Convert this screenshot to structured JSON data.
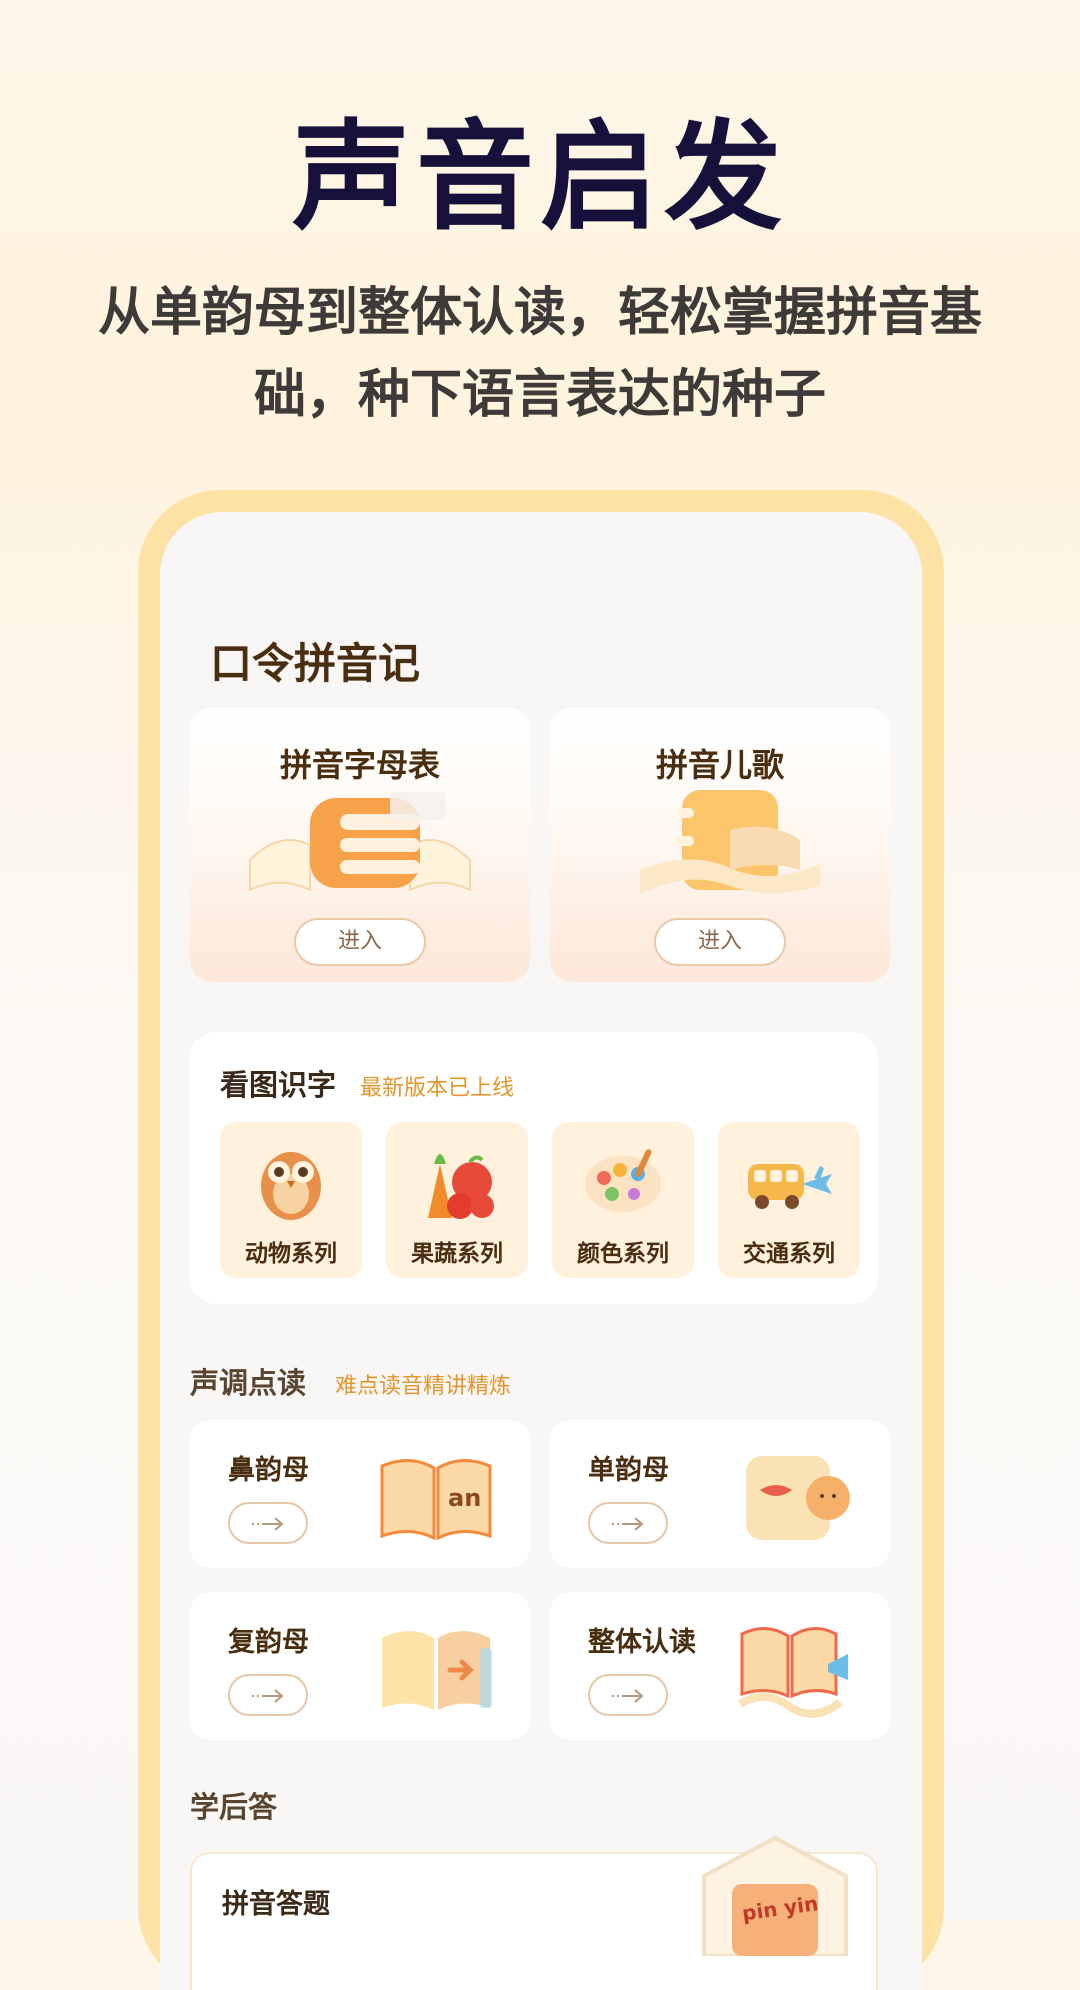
{
  "hero": {
    "title": "声音启发",
    "subtitle": "从单韵母到整体认读，轻松掌握拼音基础，种下语言表达的种子"
  },
  "app": {
    "title": "口令拼音记",
    "top_cards": [
      {
        "label": "拼音字母表",
        "button": "进入",
        "icon": "book-stack-icon"
      },
      {
        "label": "拼音儿歌",
        "button": "进入",
        "icon": "notebook-icon"
      }
    ],
    "picture_words": {
      "title": "看图识字",
      "tag": "最新版本已上线",
      "items": [
        {
          "label": "动物系列",
          "icon": "owl-icon"
        },
        {
          "label": "果蔬系列",
          "icon": "fruit-vegetable-icon"
        },
        {
          "label": "颜色系列",
          "icon": "palette-icon"
        },
        {
          "label": "交通系列",
          "icon": "vehicle-icon"
        }
      ]
    },
    "tone_reading": {
      "title": "声调点读",
      "tag": "难点读音精讲精炼",
      "items": [
        {
          "label": "鼻韵母",
          "icon": "open-book-an-icon"
        },
        {
          "label": "单韵母",
          "icon": "lips-icon"
        },
        {
          "label": "复韵母",
          "icon": "book-arrow-icon"
        },
        {
          "label": "整体认读",
          "icon": "book-megaphone-icon"
        }
      ]
    },
    "after_class": {
      "title": "学后答",
      "quiz_label": "拼音答题",
      "badge_text": "pin yin"
    }
  },
  "colors": {
    "accent": "#e3962b",
    "title_dark": "#16103a",
    "frame": "#fde2a6",
    "brown_text": "#4a2e10"
  }
}
